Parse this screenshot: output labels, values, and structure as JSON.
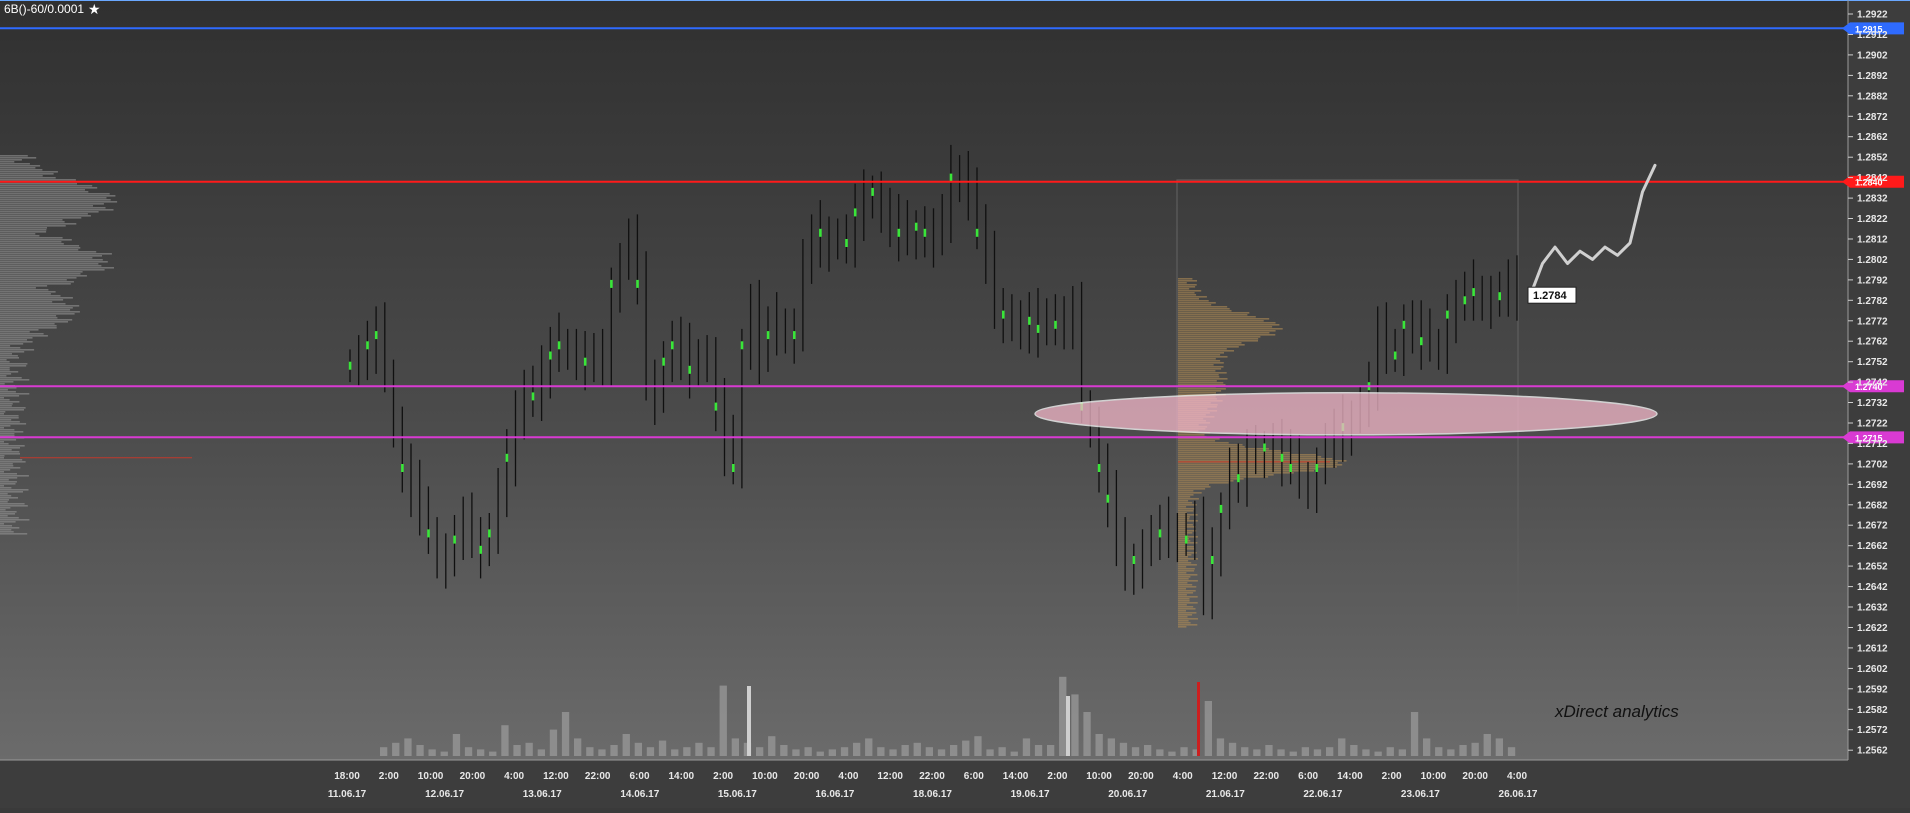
{
  "header": {
    "symbol": "6B()-60/0.0001"
  },
  "colors": {
    "background_top": "#303030",
    "background_bottom": "#6e6e6e",
    "top_line": "#2f7bff",
    "resistance": "#ff1a1a",
    "level": "#e23ad8",
    "bar": "#101010",
    "highlight": "#39e639",
    "profile": "#9b9b9b",
    "session_profile": "#b08c55",
    "ellipse": "#f3b7c9",
    "text": "#e8e8e8"
  },
  "chart_data": {
    "type": "bar",
    "title": "",
    "xlabel": "",
    "ylabel": "",
    "ylim": [
      1.2554,
      1.2934
    ],
    "price_ticks": [
      "1.2922",
      "1.2912",
      "1.2902",
      "1.2892",
      "1.2882",
      "1.2872",
      "1.2862",
      "1.2852",
      "1.2842",
      "1.2832",
      "1.2822",
      "1.2812",
      "1.2802",
      "1.2792",
      "1.2782",
      "1.2772",
      "1.2762",
      "1.2752",
      "1.2742",
      "1.2732",
      "1.2722",
      "1.2712",
      "1.2702",
      "1.2692",
      "1.2682",
      "1.2672",
      "1.2662",
      "1.2652",
      "1.2642",
      "1.2632",
      "1.2622",
      "1.2612",
      "1.2602",
      "1.2592",
      "1.2582",
      "1.2572",
      "1.2562"
    ],
    "time_labels": [
      "18:00",
      "2:00",
      "10:00",
      "20:00",
      "4:00",
      "12:00",
      "22:00",
      "6:00",
      "14:00",
      "2:00",
      "10:00",
      "20:00",
      "4:00",
      "12:00",
      "22:00",
      "6:00",
      "14:00",
      "2:00",
      "10:00",
      "20:00",
      "4:00",
      "12:00",
      "22:00",
      "6:00",
      "14:00",
      "2:00",
      "10:00",
      "20:00",
      "4:00"
    ],
    "date_labels": [
      "11.06.17",
      "12.06.17",
      "13.06.17",
      "14.06.17",
      "15.06.17",
      "16.06.17",
      "18.06.17",
      "19.06.17",
      "20.06.17",
      "21.06.17",
      "22.06.17",
      "23.06.17",
      "26.06.17"
    ],
    "price_levels": [
      {
        "value": 1.2915,
        "label": "1.2915",
        "color": "#2f6bff"
      },
      {
        "value": 1.284,
        "label": "1.2840",
        "color": "#ff1a1a"
      },
      {
        "value": 1.274,
        "label": "1.2740",
        "color": "#d93ad3"
      },
      {
        "value": 1.2715,
        "label": "1.2715",
        "color": "#d93ad3"
      }
    ],
    "last_price": "1.2784",
    "close_series": [
      1.275,
      1.2755,
      1.276,
      1.2765,
      1.2745,
      1.272,
      1.27,
      1.269,
      1.2675,
      1.2668,
      1.2658,
      1.2655,
      1.2665,
      1.2672,
      1.2668,
      1.266,
      1.2668,
      1.2688,
      1.2705,
      1.2722,
      1.274,
      1.2735,
      1.2748,
      1.2755,
      1.276,
      1.2758,
      1.2755,
      1.2752,
      1.275,
      1.2752,
      1.279,
      1.28,
      1.281,
      1.279,
      1.2745,
      1.2735,
      1.2752,
      1.276,
      1.2755,
      1.2748,
      1.2755,
      1.2752,
      1.273,
      1.271,
      1.27,
      1.276,
      1.278,
      1.2755,
      1.2765,
      1.277,
      1.2768,
      1.2765,
      1.28,
      1.281,
      1.2815,
      1.281,
      1.2812,
      1.281,
      1.2825,
      1.283,
      1.2835,
      1.2825,
      1.282,
      1.2815,
      1.2812,
      1.2818,
      1.2815,
      1.2812,
      1.282,
      1.2842,
      1.2845,
      1.2835,
      1.2815,
      1.28,
      1.278,
      1.2775,
      1.277,
      1.2768,
      1.2772,
      1.2768,
      1.2775,
      1.277,
      1.2772,
      1.2775,
      1.273,
      1.272,
      1.27,
      1.2685,
      1.266,
      1.265,
      1.2655,
      1.266,
      1.2665,
      1.2668,
      1.267,
      1.2668,
      1.2665,
      1.2672,
      1.264,
      1.2655,
      1.268,
      1.27,
      1.2695,
      1.2705,
      1.2705,
      1.271,
      1.2712,
      1.2705,
      1.27,
      1.2695,
      1.2692,
      1.27,
      1.271,
      1.2715,
      1.272,
      1.2725,
      1.273,
      1.274,
      1.2765,
      1.276,
      1.2755,
      1.277,
      1.2768,
      1.2762,
      1.276,
      1.2758,
      1.2775,
      1.278,
      1.2782,
      1.2786,
      1.2784,
      1.2782,
      1.2784,
      1.2788,
      1.2784
    ],
    "forecast_path": [
      1.2784,
      1.28,
      1.2808,
      1.28,
      1.2806,
      1.2802,
      1.2808,
      1.2804,
      1.281,
      1.2835,
      1.2848
    ],
    "volume_bars": [
      4,
      6,
      8,
      5,
      3,
      2,
      10,
      4,
      3,
      2,
      14,
      5,
      6,
      3,
      12,
      20,
      8,
      4,
      3,
      5,
      10,
      6,
      4,
      7,
      3,
      4,
      6,
      4,
      32,
      8,
      6,
      4,
      9,
      5,
      3,
      4,
      2,
      3,
      4,
      6,
      8,
      4,
      3,
      5,
      6,
      4,
      3,
      5,
      7,
      9,
      3,
      4,
      2,
      8,
      5,
      5,
      36,
      28,
      20,
      10,
      8,
      6,
      4,
      5,
      3,
      2,
      4,
      3,
      25,
      8,
      6,
      4,
      3,
      5,
      3,
      2,
      4,
      3,
      4,
      8,
      5,
      3,
      2,
      4,
      3,
      20,
      8,
      4,
      3,
      5,
      6,
      10,
      8,
      4
    ],
    "signature": "xDirect analytics"
  }
}
